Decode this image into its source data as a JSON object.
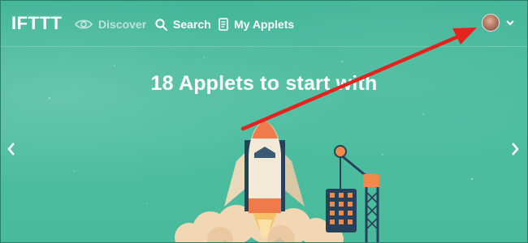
{
  "brand": {
    "logo_text": "IFTTT"
  },
  "nav": {
    "discover_label": "Discover",
    "search_label": "Search",
    "my_applets_label": "My Applets"
  },
  "hero": {
    "headline": "18 Applets to start with"
  },
  "colors": {
    "background": "#47b99b",
    "annotation_arrow": "#e4231f",
    "rocket_orange": "#ef7b4c",
    "rocket_body": "#f2ead6",
    "crane_dark": "#26415a",
    "crane_orange": "#f08a4b"
  },
  "icons": {
    "discover": "eye-icon",
    "search": "search-icon",
    "my_applets": "document-icon",
    "account_menu": "chevron-down-icon",
    "prev": "chevron-left-icon",
    "next": "chevron-right-icon"
  }
}
